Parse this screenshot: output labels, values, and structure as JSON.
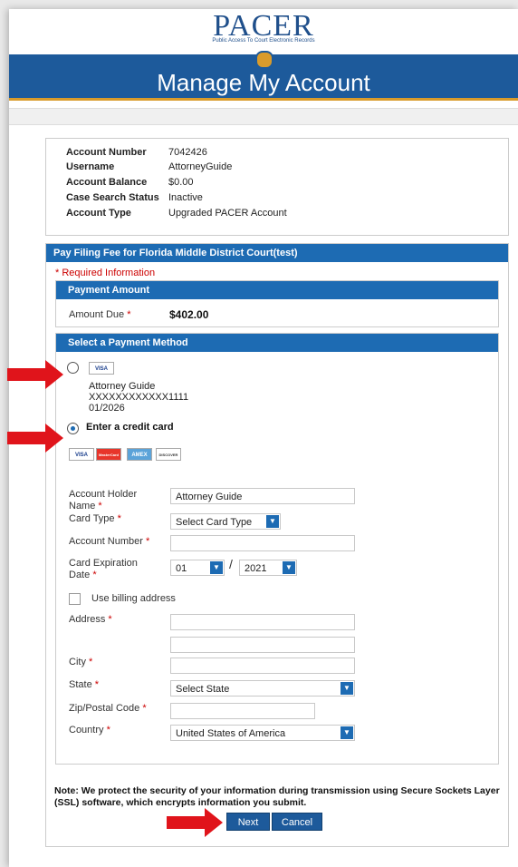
{
  "header": {
    "logo_text": "PACER",
    "logo_sub": "Public Access To Court Electronic Records",
    "title": "Manage My Account"
  },
  "account": [
    {
      "key": "Account Number",
      "value": "7042426"
    },
    {
      "key": "Username",
      "value": "AttorneyGuide"
    },
    {
      "key": "Account Balance",
      "value": "$0.00"
    },
    {
      "key": "Case Search Status",
      "value": "Inactive"
    },
    {
      "key": "Account Type",
      "value": "Upgraded PACER Account"
    }
  ],
  "panel": {
    "title": "Pay Filing Fee for Florida Middle District Court(test)",
    "required_note": "* Required Information"
  },
  "payment_amount": {
    "header": "Payment Amount",
    "label": "Amount Due",
    "value": "$402.00"
  },
  "payment_method": {
    "header": "Select a Payment Method",
    "saved_card": {
      "brand": "VISA",
      "name": "Attorney Guide",
      "number": "XXXXXXXXXXXX1111",
      "expiry": "01/2026"
    },
    "enter_card_label": "Enter a credit card",
    "card_logos": [
      "VISA",
      "MasterCard",
      "AMEX",
      "DISCOVER"
    ]
  },
  "form": {
    "holder_label": "Account Holder Name",
    "holder_value": "Attorney Guide",
    "card_type_label": "Card Type",
    "card_type_value": "Select Card Type",
    "acct_num_label": "Account Number",
    "expiry_label": "Card Expiration Date",
    "expiry_month": "01",
    "expiry_sep": "/",
    "expiry_year": "2021",
    "billing_label": "Use billing address",
    "address_label": "Address",
    "city_label": "City",
    "state_label": "State",
    "state_value": "Select State",
    "zip_label": "Zip/Postal Code",
    "country_label": "Country",
    "country_value": "United States of America",
    "required_mark": "*"
  },
  "note": "Note: We protect the security of your information during transmission using Secure Sockets Layer (SSL) software, which encrypts information you submit.",
  "buttons": {
    "next": "Next",
    "cancel": "Cancel"
  },
  "colors": {
    "primary": "#1d6bb3",
    "banner": "#1d5a9b",
    "accent": "#d99b2b",
    "arrow": "#e0141b",
    "required": "#c00"
  }
}
